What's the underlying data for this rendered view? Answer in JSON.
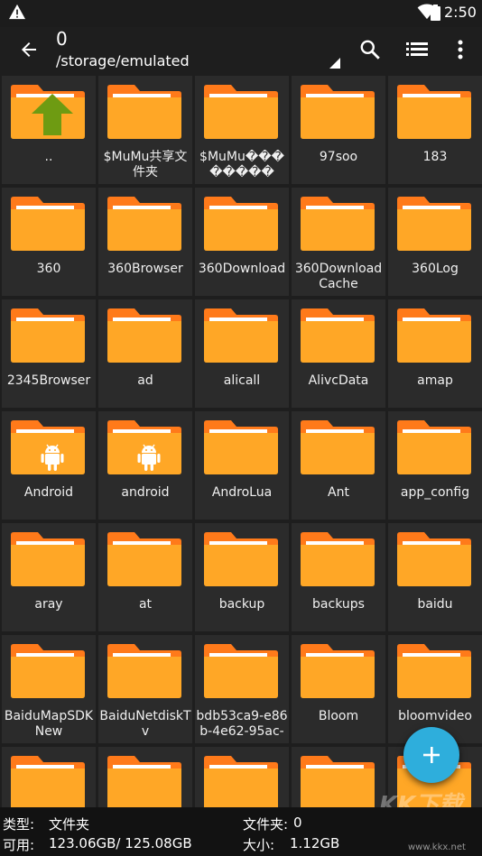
{
  "status_bar": {
    "time": "2:50"
  },
  "toolbar": {
    "title": "0",
    "path": "/storage/emulated"
  },
  "colors": {
    "folder_body": "#ffa726",
    "folder_tab": "#ff7a1a",
    "accent_fab": "#2eaedc",
    "up_arrow": "#6e9b12"
  },
  "folders": [
    {
      "name": "..",
      "badge": "up-arrow"
    },
    {
      "name": "$MuMu共享文件夹"
    },
    {
      "name": "$MuMu��������"
    },
    {
      "name": "97soo"
    },
    {
      "name": "183"
    },
    {
      "name": "360"
    },
    {
      "name": "360Browser"
    },
    {
      "name": "360Download"
    },
    {
      "name": "360DownloadCache"
    },
    {
      "name": "360Log"
    },
    {
      "name": "2345Browser"
    },
    {
      "name": "ad"
    },
    {
      "name": "alicall"
    },
    {
      "name": "AlivcData"
    },
    {
      "name": "amap"
    },
    {
      "name": "Android",
      "badge": "android"
    },
    {
      "name": "android",
      "badge": "android"
    },
    {
      "name": "AndroLua"
    },
    {
      "name": "Ant"
    },
    {
      "name": "app_config"
    },
    {
      "name": "aray"
    },
    {
      "name": "at"
    },
    {
      "name": "backup"
    },
    {
      "name": "backups"
    },
    {
      "name": "baidu"
    },
    {
      "name": "BaiduMapSDKNew"
    },
    {
      "name": "BaiduNetdiskTv"
    },
    {
      "name": "bdb53ca9-e86b-4e62-95ac-"
    },
    {
      "name": "Bloom"
    },
    {
      "name": "bloomvideo"
    },
    {
      "name": ""
    },
    {
      "name": ""
    },
    {
      "name": ""
    },
    {
      "name": ""
    },
    {
      "name": ""
    }
  ],
  "footer": {
    "type_label": "类型:",
    "type_value": "文件夹",
    "folders_label": "文件夹:",
    "folders_value": "0",
    "avail_label": "可用:",
    "avail_value": "123.06GB/ 125.08GB",
    "size_label": "大小:",
    "size_value": "1.12GB"
  },
  "watermark": {
    "logo": "KK下载",
    "url": "www.kkx.net"
  }
}
